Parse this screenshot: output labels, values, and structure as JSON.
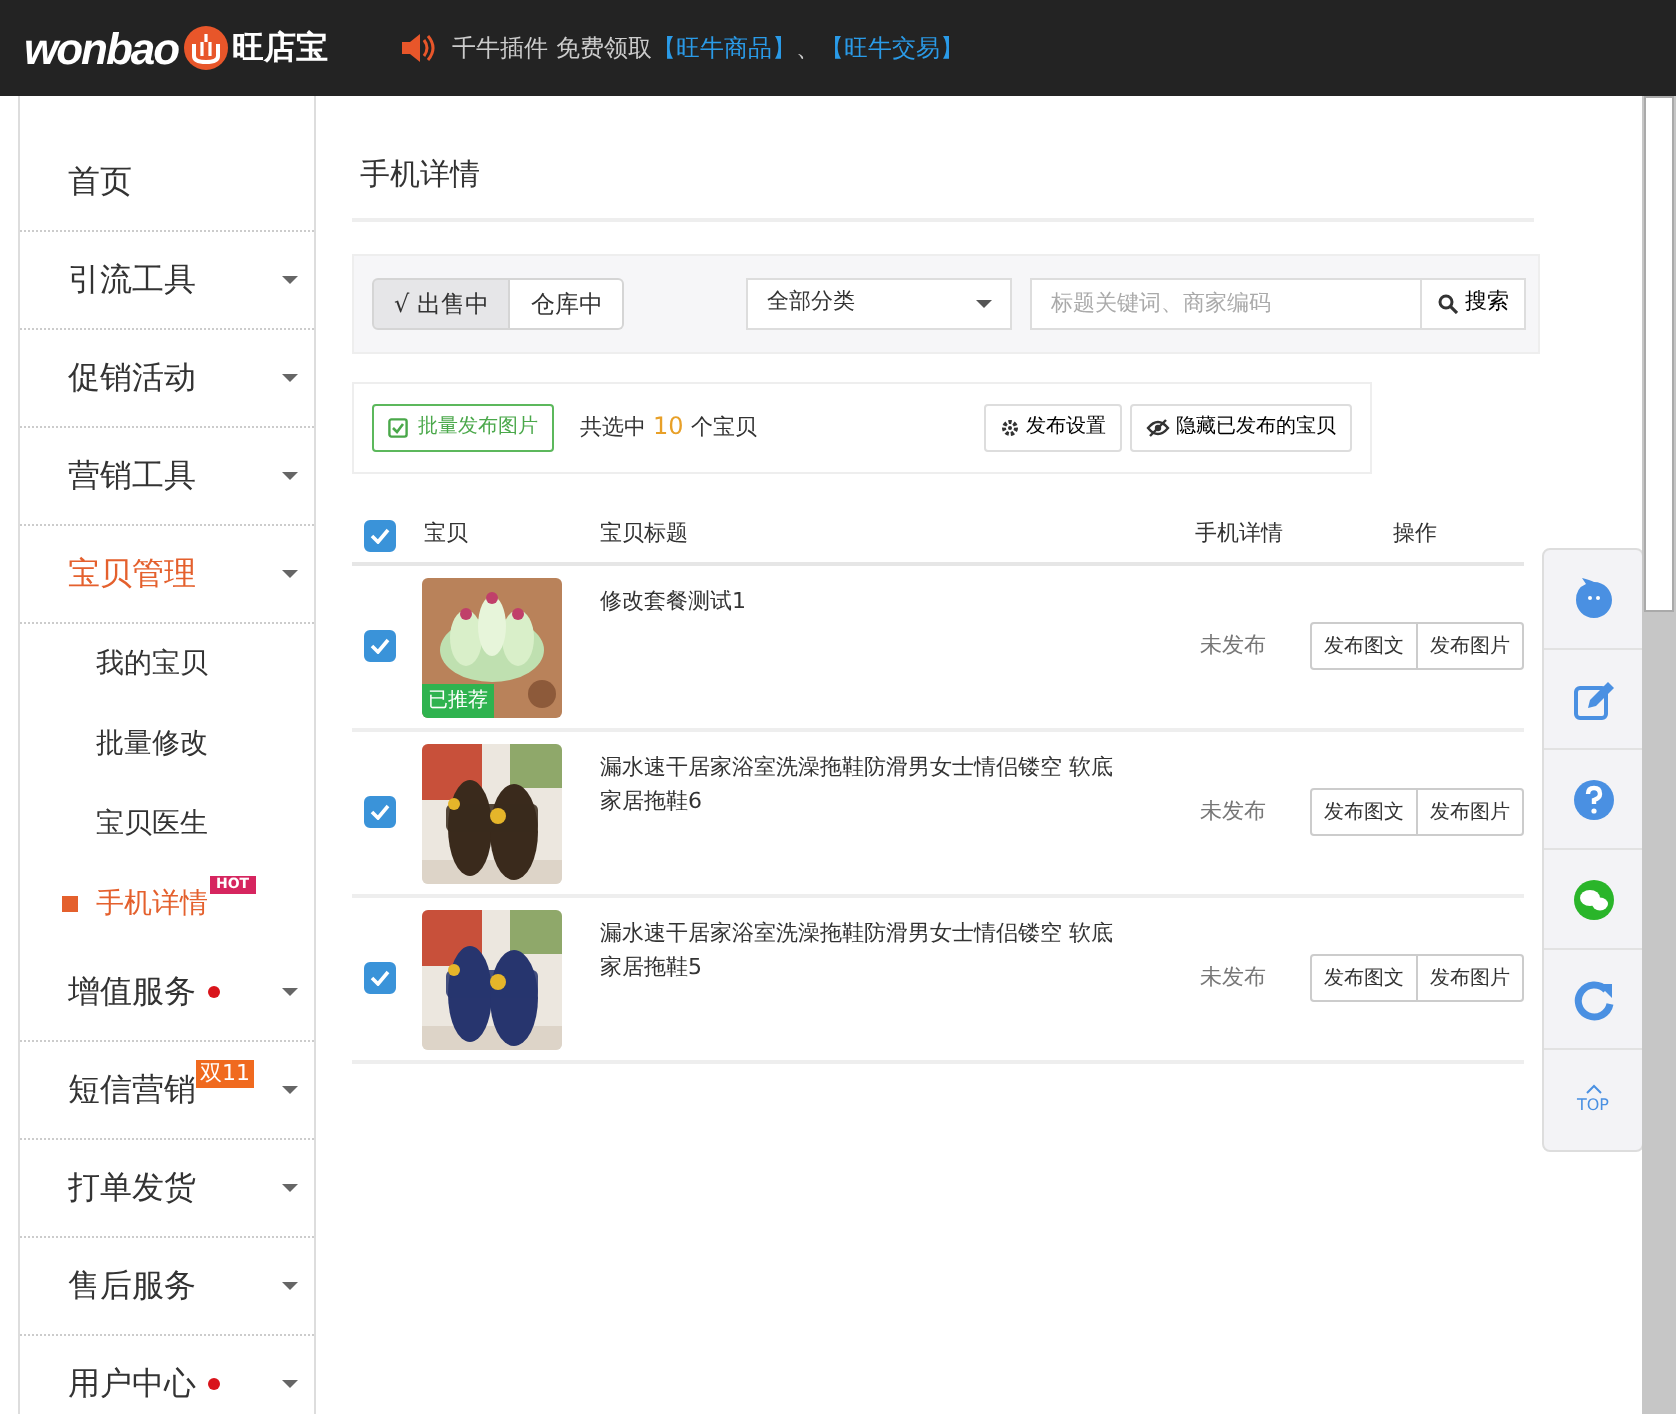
{
  "header": {
    "logo": "wonbao",
    "brand": "旺店宝",
    "notice": "千牛插件 免费领取",
    "links": [
      "【旺牛商品】",
      "【旺牛交易】"
    ],
    "separator": "、"
  },
  "sidebar": {
    "items": [
      {
        "label": "首页",
        "selected": false,
        "expandable": false
      },
      {
        "label": "引流工具",
        "selected": false,
        "expandable": true
      },
      {
        "label": "促销活动",
        "selected": false,
        "expandable": true
      },
      {
        "label": "营销工具",
        "selected": false,
        "expandable": true
      },
      {
        "label": "宝贝管理",
        "selected": true,
        "expandable": true,
        "children": [
          {
            "label": "我的宝贝",
            "selected": false
          },
          {
            "label": "批量修改",
            "selected": false
          },
          {
            "label": "宝贝医生",
            "selected": false
          },
          {
            "label": "手机详情",
            "selected": true,
            "badge": "HOT"
          }
        ]
      },
      {
        "label": "增值服务",
        "selected": false,
        "expandable": true,
        "dot": true
      },
      {
        "label": "短信营销",
        "selected": false,
        "expandable": true,
        "badge": "双11"
      },
      {
        "label": "打单发货",
        "selected": false,
        "expandable": true
      },
      {
        "label": "售后服务",
        "selected": false,
        "expandable": true
      },
      {
        "label": "用户中心",
        "selected": false,
        "expandable": true,
        "dot": true
      }
    ]
  },
  "page_title": "手机详情",
  "filter": {
    "tabs": [
      {
        "label": "√ 出售中",
        "selected": true
      },
      {
        "label": "仓库中",
        "selected": false
      }
    ],
    "category": "全部分类",
    "search": {
      "placeholder": "标题关键词、商家编码"
    },
    "search_button": "搜索"
  },
  "actions": {
    "batch_button": "批量发布图片",
    "summary_prefix": "共选中",
    "count": "10",
    "summary_suffix": "个宝贝",
    "buttons": [
      {
        "kind": "settings",
        "label": "发布设置"
      },
      {
        "kind": "hide",
        "label": "隐藏已发布的宝贝"
      }
    ]
  },
  "table": {
    "select_all": {
      "checked": true
    },
    "columns": [
      "宝贝",
      "宝贝标题",
      "手机详情",
      "操作"
    ],
    "rows": [
      {
        "checked": true,
        "image": {
          "kind": "picture"
        },
        "tag": "已推荐",
        "title": "修改套餐测试1",
        "status": "未发布",
        "buttons": [
          "发布图文",
          "发布图片"
        ]
      },
      {
        "checked": true,
        "image": {
          "kind": "picture"
        },
        "title": "漏水速干居家浴室洗澡拖鞋防滑男女士情侣镂空 软底家居拖鞋6",
        "status": "未发布",
        "buttons": [
          "发布图文",
          "发布图片"
        ]
      },
      {
        "checked": true,
        "image": {
          "kind": "picture"
        },
        "title": "漏水速干居家浴室洗澡拖鞋防滑男女士情侣镂空 软底家居拖鞋5",
        "status": "未发布",
        "buttons": [
          "发布图文",
          "发布图片"
        ]
      }
    ]
  },
  "float_toolbar": {
    "items": [
      {
        "kind": "chat"
      },
      {
        "kind": "edit"
      },
      {
        "kind": "help"
      },
      {
        "kind": "wechat"
      },
      {
        "kind": "refresh"
      },
      {
        "kind": "top",
        "label": "TOP"
      }
    ]
  }
}
